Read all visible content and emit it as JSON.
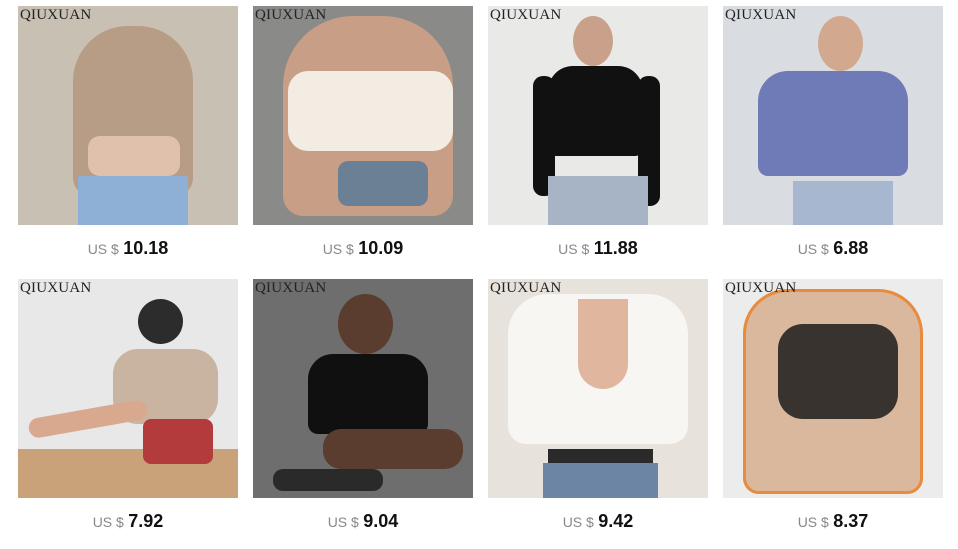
{
  "products": [
    {
      "brand": "QIUXUAN",
      "currency": "US $",
      "price": "10.18",
      "bg": "#c9c0b4",
      "garment": "#b89d86",
      "accent": "#f0e5d7"
    },
    {
      "brand": "QIUXUAN",
      "currency": "US $",
      "price": "10.09",
      "bg": "#8a8a88",
      "garment": "#f3ece3",
      "accent": "#6b5a4f"
    },
    {
      "brand": "QIUXUAN",
      "currency": "US $",
      "price": "11.88",
      "bg": "#e9e9e8",
      "garment": "#111111",
      "accent": "#a7b4c6"
    },
    {
      "brand": "QIUXUAN",
      "currency": "US $",
      "price": "6.88",
      "bg": "#d9dde2",
      "garment": "#6e7bb6",
      "accent": "#a7b7cf"
    },
    {
      "brand": "QIUXUAN",
      "currency": "US $",
      "price": "7.92",
      "bg": "#e8e8e8",
      "garment": "#c8b4a0",
      "accent": "#b33b3b"
    },
    {
      "brand": "QIUXUAN",
      "currency": "US $",
      "price": "9.04",
      "bg": "#6e6e6e",
      "garment": "#101010",
      "accent": "#5a3d2f"
    },
    {
      "brand": "QIUXUAN",
      "currency": "US $",
      "price": "9.42",
      "bg": "#e7e2dc",
      "garment": "#f7f6f2",
      "accent": "#6c85a4"
    },
    {
      "brand": "QIUXUAN",
      "currency": "US $",
      "price": "8.37",
      "bg": "#ececec",
      "garment": "#d9b89d",
      "accent": "#1b1b1b"
    }
  ]
}
